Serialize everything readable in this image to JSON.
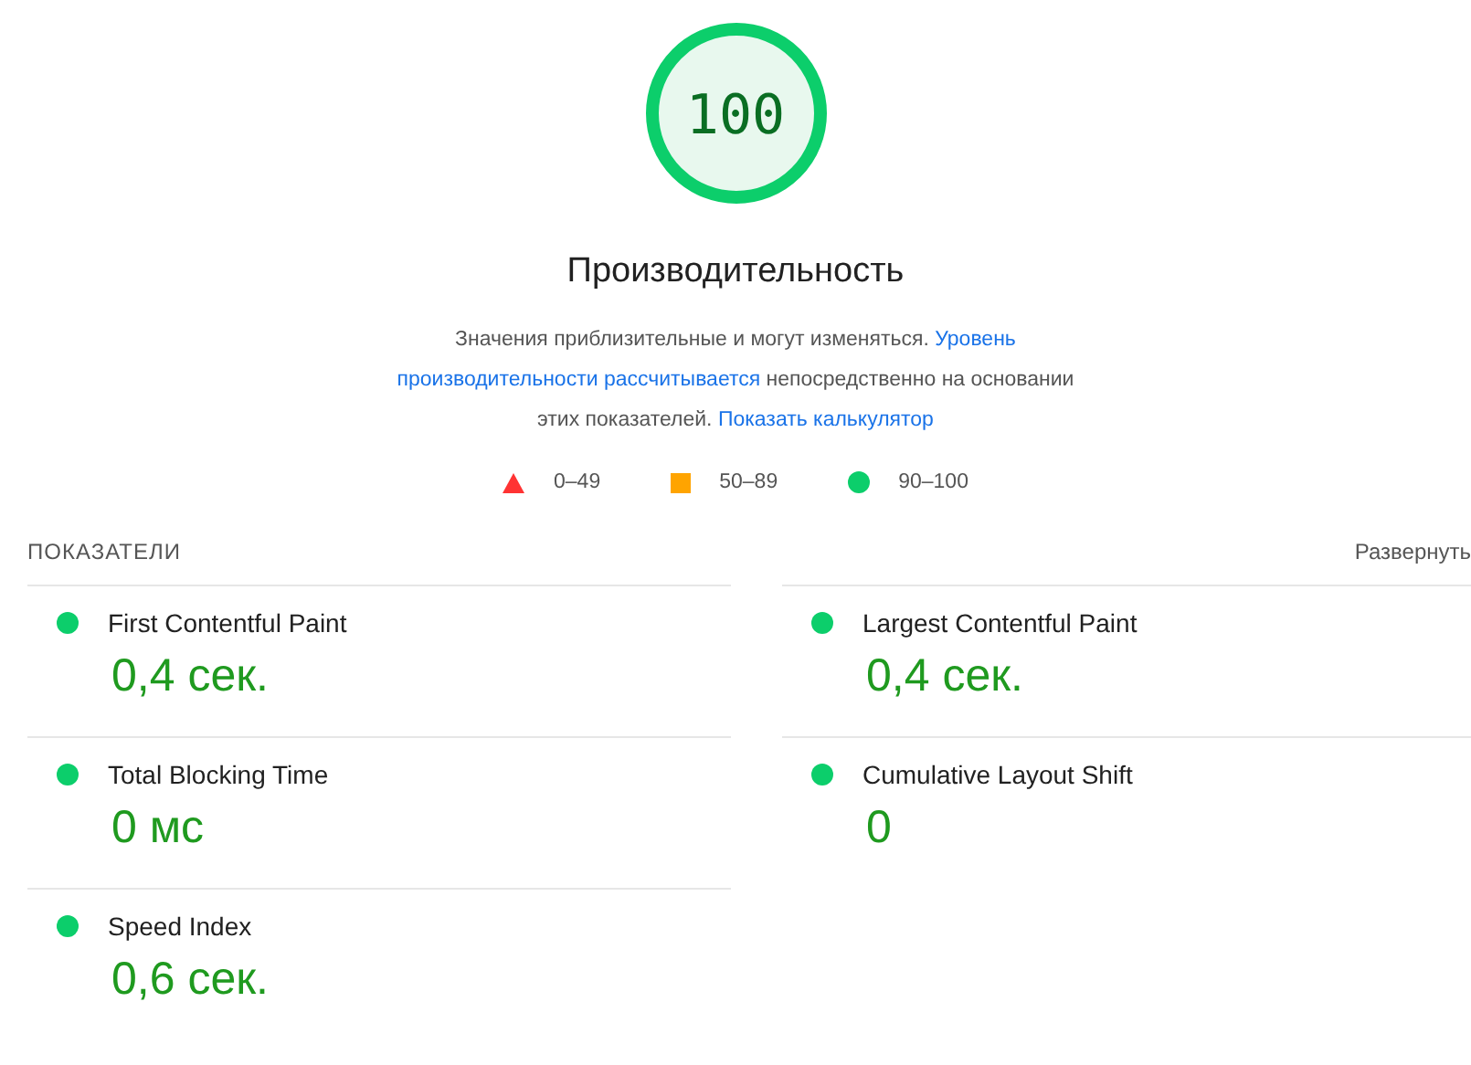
{
  "score": {
    "value": "100",
    "level": 1.0
  },
  "title": "Производительность",
  "description": [
    [
      {
        "text": "Значения приблизительные и могут изменяться. ",
        "link": false
      },
      {
        "text": "Уровень",
        "link": true
      }
    ],
    [
      {
        "text": "производительности рассчитывается",
        "link": true
      },
      {
        "text": " непосредственно на основании",
        "link": false
      }
    ],
    [
      {
        "text": "этих показателей. ",
        "link": false
      },
      {
        "text": "Показать калькулятор",
        "link": true
      }
    ]
  ],
  "legend": [
    {
      "kind": "triangle",
      "color": "#ff3333",
      "label": "0–49"
    },
    {
      "kind": "square",
      "color": "#ffa400",
      "label": "50–89"
    },
    {
      "kind": "circle",
      "color": "#0cce6b",
      "label": "90–100"
    }
  ],
  "metrics_header": {
    "title": "ПОКАЗАТЕЛИ",
    "toggle": "Развернуть"
  },
  "metrics": [
    {
      "name": "First Contentful Paint",
      "value": "0,4 сек.",
      "color": "#0cce6b"
    },
    {
      "name": "Largest Contentful Paint",
      "value": "0,4 сек.",
      "color": "#0cce6b"
    },
    {
      "name": "Total Blocking Time",
      "value": "0 мс",
      "color": "#0cce6b"
    },
    {
      "name": "Cumulative Layout Shift",
      "value": "0",
      "color": "#0cce6b"
    },
    {
      "name": "Speed Index",
      "value": "0,6 сек.",
      "color": "#0cce6b"
    }
  ]
}
